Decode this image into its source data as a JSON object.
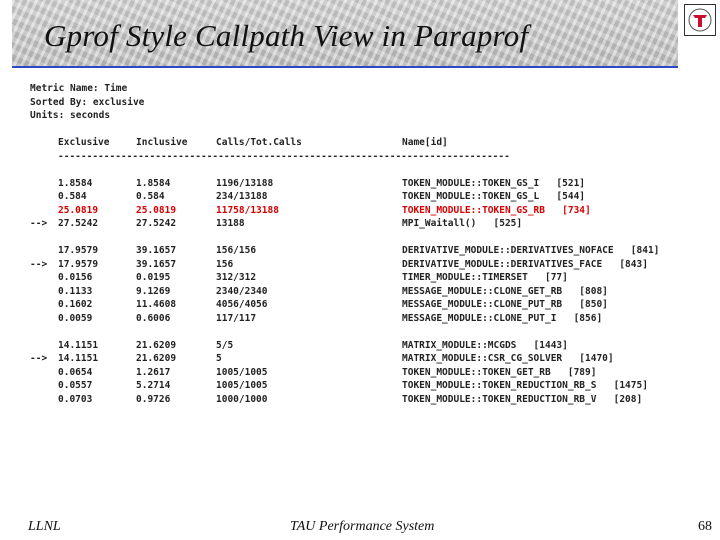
{
  "slide": {
    "title": "Gprof Style Callpath View in Paraprof",
    "footer_left": "LLNL",
    "footer_center": "TAU Performance System",
    "page_number": "68"
  },
  "report": {
    "metric_line": "Metric Name: Time",
    "sorted_line": "Sorted By: exclusive",
    "units_line": "Units: seconds",
    "headers": {
      "exclusive": "Exclusive",
      "inclusive": "Inclusive",
      "calls": "Calls/Tot.Calls",
      "name": "Name[id]"
    },
    "divider": "-------------------------------------------------------------------------------",
    "groups": [
      {
        "rows": [
          {
            "arrow": "",
            "exclusive": "1.8584",
            "inclusive": "1.8584",
            "calls": "1196/13188",
            "name": "TOKEN_MODULE::TOKEN_GS_I   [521]"
          },
          {
            "arrow": "",
            "exclusive": "0.584",
            "inclusive": "0.584",
            "calls": "234/13188",
            "name": "TOKEN_MODULE::TOKEN_GS_L   [544]"
          },
          {
            "arrow": "",
            "exclusive": "25.0819",
            "inclusive": "25.0819",
            "calls": "11758/13188",
            "name": "TOKEN_MODULE::TOKEN_GS_RB   [734]",
            "highlight": true
          },
          {
            "arrow": "-->",
            "exclusive": "27.5242",
            "inclusive": "27.5242",
            "calls": "13188",
            "name": "MPI_Waitall()   [525]"
          }
        ]
      },
      {
        "rows": [
          {
            "arrow": "",
            "exclusive": "17.9579",
            "inclusive": "39.1657",
            "calls": "156/156",
            "name": "DERIVATIVE_MODULE::DERIVATIVES_NOFACE   [841]"
          },
          {
            "arrow": "-->",
            "exclusive": "17.9579",
            "inclusive": "39.1657",
            "calls": "156",
            "name": "DERIVATIVE_MODULE::DERIVATIVES_FACE   [843]"
          },
          {
            "arrow": "",
            "exclusive": "0.0156",
            "inclusive": "0.0195",
            "calls": "312/312",
            "name": "TIMER_MODULE::TIMERSET   [77]"
          },
          {
            "arrow": "",
            "exclusive": "0.1133",
            "inclusive": "9.1269",
            "calls": "2340/2340",
            "name": "MESSAGE_MODULE::CLONE_GET_RB   [808]"
          },
          {
            "arrow": "",
            "exclusive": "0.1602",
            "inclusive": "11.4608",
            "calls": "4056/4056",
            "name": "MESSAGE_MODULE::CLONE_PUT_RB   [850]"
          },
          {
            "arrow": "",
            "exclusive": "0.0059",
            "inclusive": "0.6006",
            "calls": "117/117",
            "name": "MESSAGE_MODULE::CLONE_PUT_I   [856]"
          }
        ]
      },
      {
        "rows": [
          {
            "arrow": "",
            "exclusive": "14.1151",
            "inclusive": "21.6209",
            "calls": "5/5",
            "name": "MATRIX_MODULE::MCGDS   [1443]"
          },
          {
            "arrow": "-->",
            "exclusive": "14.1151",
            "inclusive": "21.6209",
            "calls": "5",
            "name": "MATRIX_MODULE::CSR_CG_SOLVER   [1470]"
          },
          {
            "arrow": "",
            "exclusive": "0.0654",
            "inclusive": "1.2617",
            "calls": "1005/1005",
            "name": "TOKEN_MODULE::TOKEN_GET_RB   [789]"
          },
          {
            "arrow": "",
            "exclusive": "0.0557",
            "inclusive": "5.2714",
            "calls": "1005/1005",
            "name": "TOKEN_MODULE::TOKEN_REDUCTION_RB_S   [1475]"
          },
          {
            "arrow": "",
            "exclusive": "0.0703",
            "inclusive": "0.9726",
            "calls": "1000/1000",
            "name": "TOKEN_MODULE::TOKEN_REDUCTION_RB_V   [208]"
          }
        ]
      }
    ]
  }
}
